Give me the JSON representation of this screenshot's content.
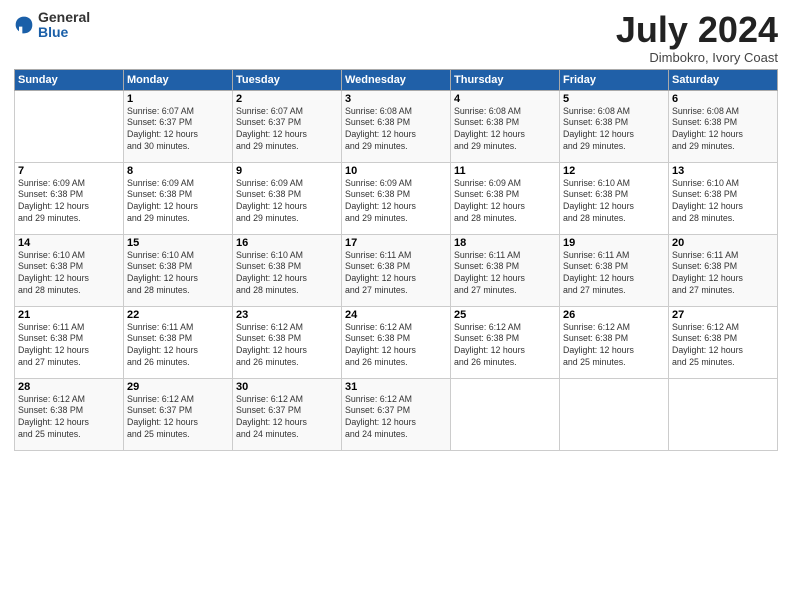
{
  "header": {
    "logo_general": "General",
    "logo_blue": "Blue",
    "month_title": "July 2024",
    "location": "Dimbokro, Ivory Coast"
  },
  "columns": [
    "Sunday",
    "Monday",
    "Tuesday",
    "Wednesday",
    "Thursday",
    "Friday",
    "Saturday"
  ],
  "weeks": [
    [
      {
        "day": "",
        "info": ""
      },
      {
        "day": "1",
        "info": "Sunrise: 6:07 AM\nSunset: 6:37 PM\nDaylight: 12 hours\nand 30 minutes."
      },
      {
        "day": "2",
        "info": "Sunrise: 6:07 AM\nSunset: 6:37 PM\nDaylight: 12 hours\nand 29 minutes."
      },
      {
        "day": "3",
        "info": "Sunrise: 6:08 AM\nSunset: 6:38 PM\nDaylight: 12 hours\nand 29 minutes."
      },
      {
        "day": "4",
        "info": "Sunrise: 6:08 AM\nSunset: 6:38 PM\nDaylight: 12 hours\nand 29 minutes."
      },
      {
        "day": "5",
        "info": "Sunrise: 6:08 AM\nSunset: 6:38 PM\nDaylight: 12 hours\nand 29 minutes."
      },
      {
        "day": "6",
        "info": "Sunrise: 6:08 AM\nSunset: 6:38 PM\nDaylight: 12 hours\nand 29 minutes."
      }
    ],
    [
      {
        "day": "7",
        "info": "Sunrise: 6:09 AM\nSunset: 6:38 PM\nDaylight: 12 hours\nand 29 minutes."
      },
      {
        "day": "8",
        "info": "Sunrise: 6:09 AM\nSunset: 6:38 PM\nDaylight: 12 hours\nand 29 minutes."
      },
      {
        "day": "9",
        "info": "Sunrise: 6:09 AM\nSunset: 6:38 PM\nDaylight: 12 hours\nand 29 minutes."
      },
      {
        "day": "10",
        "info": "Sunrise: 6:09 AM\nSunset: 6:38 PM\nDaylight: 12 hours\nand 29 minutes."
      },
      {
        "day": "11",
        "info": "Sunrise: 6:09 AM\nSunset: 6:38 PM\nDaylight: 12 hours\nand 28 minutes."
      },
      {
        "day": "12",
        "info": "Sunrise: 6:10 AM\nSunset: 6:38 PM\nDaylight: 12 hours\nand 28 minutes."
      },
      {
        "day": "13",
        "info": "Sunrise: 6:10 AM\nSunset: 6:38 PM\nDaylight: 12 hours\nand 28 minutes."
      }
    ],
    [
      {
        "day": "14",
        "info": "Sunrise: 6:10 AM\nSunset: 6:38 PM\nDaylight: 12 hours\nand 28 minutes."
      },
      {
        "day": "15",
        "info": "Sunrise: 6:10 AM\nSunset: 6:38 PM\nDaylight: 12 hours\nand 28 minutes."
      },
      {
        "day": "16",
        "info": "Sunrise: 6:10 AM\nSunset: 6:38 PM\nDaylight: 12 hours\nand 28 minutes."
      },
      {
        "day": "17",
        "info": "Sunrise: 6:11 AM\nSunset: 6:38 PM\nDaylight: 12 hours\nand 27 minutes."
      },
      {
        "day": "18",
        "info": "Sunrise: 6:11 AM\nSunset: 6:38 PM\nDaylight: 12 hours\nand 27 minutes."
      },
      {
        "day": "19",
        "info": "Sunrise: 6:11 AM\nSunset: 6:38 PM\nDaylight: 12 hours\nand 27 minutes."
      },
      {
        "day": "20",
        "info": "Sunrise: 6:11 AM\nSunset: 6:38 PM\nDaylight: 12 hours\nand 27 minutes."
      }
    ],
    [
      {
        "day": "21",
        "info": "Sunrise: 6:11 AM\nSunset: 6:38 PM\nDaylight: 12 hours\nand 27 minutes."
      },
      {
        "day": "22",
        "info": "Sunrise: 6:11 AM\nSunset: 6:38 PM\nDaylight: 12 hours\nand 26 minutes."
      },
      {
        "day": "23",
        "info": "Sunrise: 6:12 AM\nSunset: 6:38 PM\nDaylight: 12 hours\nand 26 minutes."
      },
      {
        "day": "24",
        "info": "Sunrise: 6:12 AM\nSunset: 6:38 PM\nDaylight: 12 hours\nand 26 minutes."
      },
      {
        "day": "25",
        "info": "Sunrise: 6:12 AM\nSunset: 6:38 PM\nDaylight: 12 hours\nand 26 minutes."
      },
      {
        "day": "26",
        "info": "Sunrise: 6:12 AM\nSunset: 6:38 PM\nDaylight: 12 hours\nand 25 minutes."
      },
      {
        "day": "27",
        "info": "Sunrise: 6:12 AM\nSunset: 6:38 PM\nDaylight: 12 hours\nand 25 minutes."
      }
    ],
    [
      {
        "day": "28",
        "info": "Sunrise: 6:12 AM\nSunset: 6:38 PM\nDaylight: 12 hours\nand 25 minutes."
      },
      {
        "day": "29",
        "info": "Sunrise: 6:12 AM\nSunset: 6:37 PM\nDaylight: 12 hours\nand 25 minutes."
      },
      {
        "day": "30",
        "info": "Sunrise: 6:12 AM\nSunset: 6:37 PM\nDaylight: 12 hours\nand 24 minutes."
      },
      {
        "day": "31",
        "info": "Sunrise: 6:12 AM\nSunset: 6:37 PM\nDaylight: 12 hours\nand 24 minutes."
      },
      {
        "day": "",
        "info": ""
      },
      {
        "day": "",
        "info": ""
      },
      {
        "day": "",
        "info": ""
      }
    ]
  ]
}
